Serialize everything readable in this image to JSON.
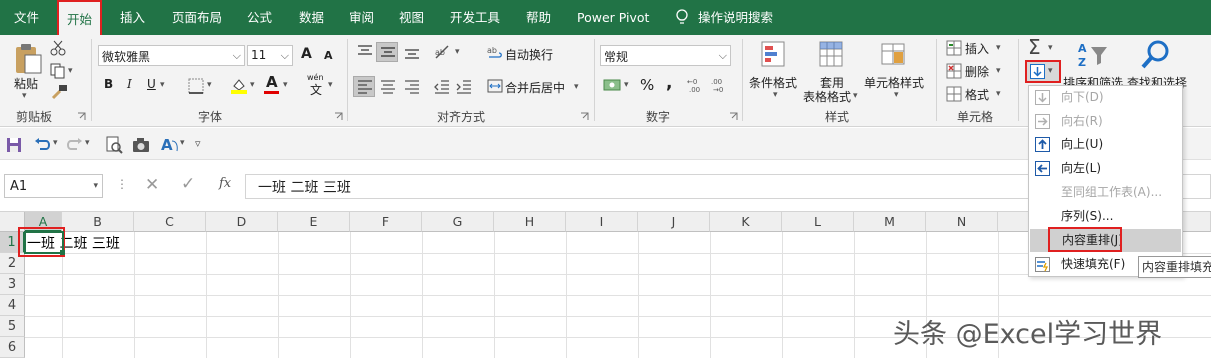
{
  "menu": {
    "tabs": [
      "文件",
      "开始",
      "插入",
      "页面布局",
      "公式",
      "数据",
      "审阅",
      "视图",
      "开发工具",
      "帮助",
      "Power Pivot"
    ],
    "search": "操作说明搜索"
  },
  "ribbon": {
    "clipboard": {
      "paste": "粘贴",
      "label": "剪贴板"
    },
    "font": {
      "name": "微软雅黑",
      "size": "11",
      "label": "字体",
      "bold": "B",
      "italic": "I",
      "underline": "U",
      "grow": "A",
      "shrink": "A",
      "wen": "wén"
    },
    "align": {
      "wrap": "自动换行",
      "merge": "合并后居中",
      "label": "对齐方式"
    },
    "number": {
      "format": "常规",
      "percent": "%",
      "comma": ",",
      "label": "数字"
    },
    "styles": {
      "conditional": "条件格式",
      "table1": "套用",
      "table2": "表格格式",
      "cell": "单元格样式",
      "label": "样式"
    },
    "cells": {
      "insert": "插入",
      "delete": "删除",
      "format": "格式",
      "label": "单元格"
    },
    "editing": {
      "sort": "排序和筛选",
      "find": "查找和选择"
    }
  },
  "formula_bar": {
    "name_box": "A1",
    "fx": "fx",
    "content": "一班 二班 三班"
  },
  "grid": {
    "columns": [
      "A",
      "B",
      "C",
      "D",
      "E",
      "F",
      "G",
      "H",
      "I",
      "J",
      "K",
      "L",
      "M",
      "N"
    ],
    "rows": [
      "1",
      "2",
      "3",
      "4",
      "5",
      "6"
    ],
    "cell_a1": "一班 二班 三班"
  },
  "fill_menu": {
    "items": [
      {
        "label": "向下(D)",
        "enabled": false,
        "icon": "arrow-down-icon"
      },
      {
        "label": "向右(R)",
        "enabled": false,
        "icon": "arrow-right-icon"
      },
      {
        "label": "向上(U)",
        "enabled": true,
        "icon": "arrow-up-icon"
      },
      {
        "label": "向左(L)",
        "enabled": true,
        "icon": "arrow-left-icon"
      },
      {
        "label": "至同组工作表(A)...",
        "enabled": false,
        "icon": ""
      },
      {
        "label": "序列(S)...",
        "enabled": true,
        "icon": ""
      },
      {
        "label": "内容重排(J)",
        "enabled": true,
        "icon": "",
        "highlighted": true
      },
      {
        "label": "快速填充(F)",
        "enabled": true,
        "icon": "flash-fill-icon"
      }
    ]
  },
  "tooltip": "内容重排填充",
  "watermark": "头条 @Excel学习世界",
  "colors": {
    "excel_green": "#217346",
    "highlight_red": "#e02020",
    "menu_hover": "#d0d0d0"
  }
}
